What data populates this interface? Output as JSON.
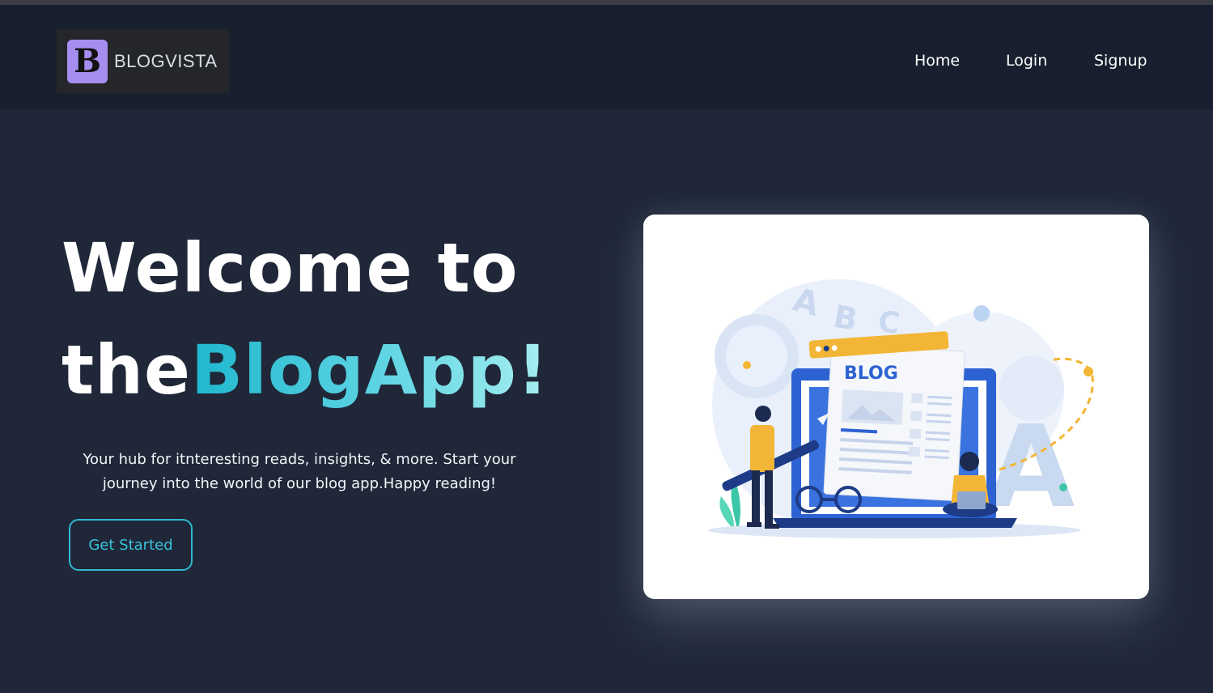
{
  "brand": {
    "logo_letter": "B",
    "name": "BLOGVISTA"
  },
  "nav": {
    "home": "Home",
    "login": "Login",
    "signup": "Signup"
  },
  "hero": {
    "title_line1": "Welcome to",
    "title_the": "the",
    "title_accent": "BlogApp!",
    "subtitle": "Your hub for itnteresting reads, insights, & more. Start your journey into the world of our blog app.Happy reading!",
    "cta": "Get Started"
  },
  "illustration": {
    "blog_label": "BLOG",
    "floating_letters": [
      "A",
      "B",
      "C"
    ],
    "big_letter": "A"
  },
  "colors": {
    "background": "#1f2738",
    "navbar": "#181f2e",
    "accent": "#2fb9d2",
    "logo_mark": "#a58ef0"
  }
}
